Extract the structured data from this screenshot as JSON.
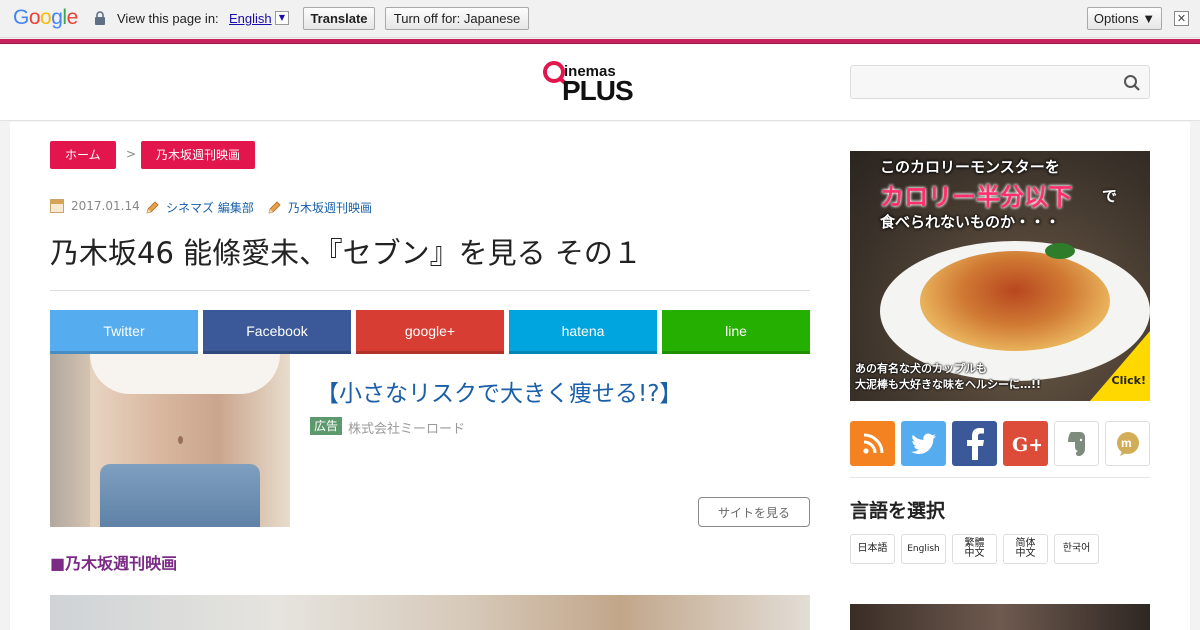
{
  "translate_bar": {
    "logo_letters": [
      {
        "ch": "G",
        "color": "#4285f4"
      },
      {
        "ch": "o",
        "color": "#ea4335"
      },
      {
        "ch": "o",
        "color": "#fbbc05"
      },
      {
        "ch": "g",
        "color": "#4285f4"
      },
      {
        "ch": "l",
        "color": "#34a853"
      },
      {
        "ch": "e",
        "color": "#ea4335"
      }
    ],
    "prompt": "View this page in:",
    "language": "English",
    "language_arrow": "▼",
    "translate_label": "Translate",
    "turn_off_label": "Turn off for: Japanese",
    "options_label": "Options ▼",
    "close_label": "✕"
  },
  "header": {
    "logo_top": "inemas",
    "logo_bottom": "PLUS",
    "search_placeholder": "",
    "search_icon": "search-icon"
  },
  "breadcrumb": {
    "home": "ホーム",
    "separator": ">",
    "current": "乃木坂週刊映画"
  },
  "meta": {
    "date": "2017.01.14",
    "author": "シネマズ 編集部",
    "category": "乃木坂週刊映画"
  },
  "article_title": "乃木坂46 能條愛未、『セブン』を見る その１",
  "share_buttons": [
    {
      "label": "Twitter",
      "color": "#55acee"
    },
    {
      "label": "Facebook",
      "color": "#3b5998"
    },
    {
      "label": "google+",
      "color": "#d73d32"
    },
    {
      "label": "hatena",
      "color": "#00a4de"
    },
    {
      "label": "line",
      "color": "#25af00"
    }
  ],
  "ad": {
    "title": "【小さなリスクで大きく痩せる!?】",
    "badge": "広告",
    "sponsor": "株式会社ミーロード",
    "cta": "サイトを見る"
  },
  "section_heading": "■乃木坂週刊映画",
  "sidebar": {
    "banner": {
      "line1": "このカロリーモンスターを",
      "line2": "カロリー半分以下",
      "line2_suffix": "で",
      "line3": "食べられないものか・・・",
      "line4": "あの有名な犬のカップルも\n大泥棒も大好きな味をヘルシーに…!!",
      "click": "Click!"
    },
    "social_icons": [
      {
        "name": "rss-icon",
        "color": "#f58220"
      },
      {
        "name": "twitter-icon",
        "color": "#55acee"
      },
      {
        "name": "facebook-icon",
        "color": "#3b5998"
      },
      {
        "name": "googleplus-icon",
        "color": "#dd4b39"
      },
      {
        "name": "evernote-icon",
        "color": "#ffffff"
      },
      {
        "name": "mixi-icon",
        "color": "#ffffff"
      }
    ],
    "language_heading": "言語を選択",
    "languages": [
      "日本語",
      "English",
      "繁體\n中文",
      "简体\n中文",
      "한국어"
    ]
  }
}
